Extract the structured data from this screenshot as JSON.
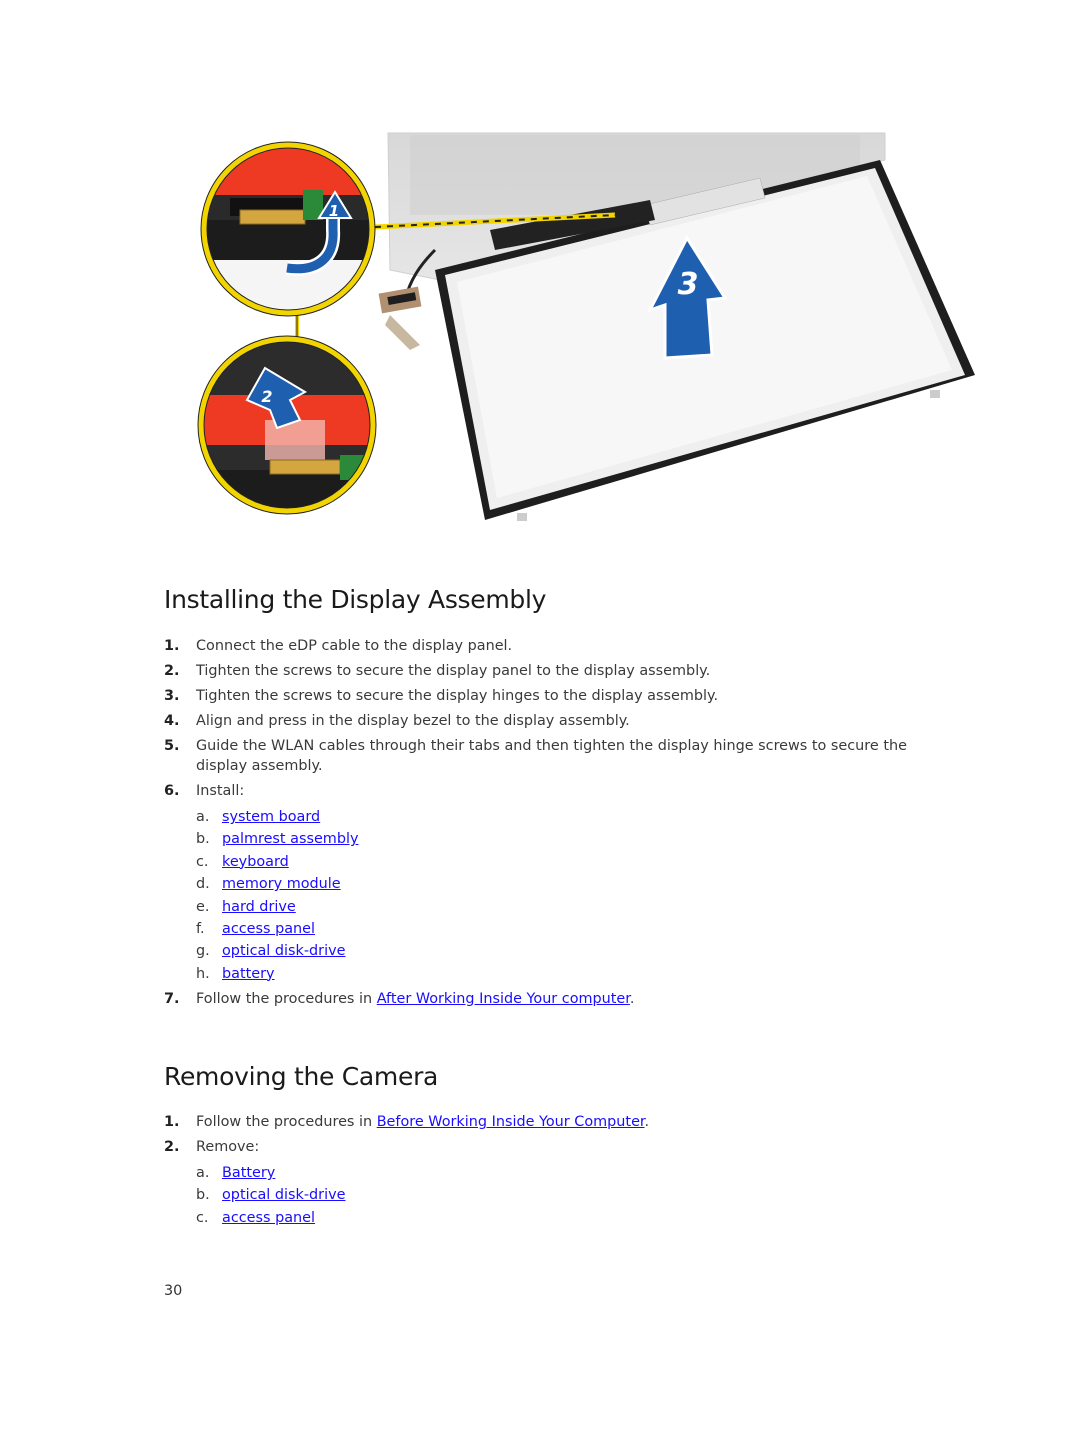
{
  "figure": {
    "description": "Display panel removal illustration",
    "callouts": [
      {
        "label": "1",
        "icon": "curved-arrow-up-icon"
      },
      {
        "label": "2",
        "icon": "arrow-up-left-icon"
      },
      {
        "label": "3",
        "icon": "arrow-up-icon"
      }
    ],
    "colors": {
      "callout_ring": "#f2d500",
      "arrow": "#1f5fb0",
      "bracket": "#e8301c"
    }
  },
  "section1": {
    "title": "Installing the Display Assembly",
    "steps": [
      {
        "num": "1.",
        "text": "Connect the eDP cable to the display panel."
      },
      {
        "num": "2.",
        "text": "Tighten the screws to secure the display panel to the display assembly."
      },
      {
        "num": "3.",
        "text": "Tighten the screws to secure the display hinges to the display assembly."
      },
      {
        "num": "4.",
        "text": "Align and press in the display bezel to the display assembly."
      },
      {
        "num": "5.",
        "text": "Guide the WLAN cables through their tabs and then tighten the display hinge screws to secure the display assembly."
      },
      {
        "num": "6.",
        "text": "Install:",
        "subitems": [
          {
            "letter": "a.",
            "link": "system board"
          },
          {
            "letter": "b.",
            "link": "palmrest assembly"
          },
          {
            "letter": "c.",
            "link": "keyboard"
          },
          {
            "letter": "d.",
            "link": "memory module"
          },
          {
            "letter": "e.",
            "link": "hard drive"
          },
          {
            "letter": "f.",
            "link": "access panel"
          },
          {
            "letter": "g.",
            "link": "optical disk-drive"
          },
          {
            "letter": "h.",
            "link": "battery"
          }
        ]
      },
      {
        "num": "7.",
        "text": "Follow the procedures in ",
        "link": "After Working Inside Your computer",
        "suffix": "."
      }
    ]
  },
  "section2": {
    "title": "Removing the Camera",
    "steps": [
      {
        "num": "1.",
        "text": "Follow the procedures in ",
        "link": "Before Working Inside Your Computer",
        "suffix": "."
      },
      {
        "num": "2.",
        "text": "Remove:",
        "subitems": [
          {
            "letter": "a.",
            "link": "Battery"
          },
          {
            "letter": "b.",
            "link": "optical disk-drive"
          },
          {
            "letter": "c.",
            "link": "access panel"
          }
        ]
      }
    ]
  },
  "page_number": "30",
  "link_color": "#1a0dff"
}
